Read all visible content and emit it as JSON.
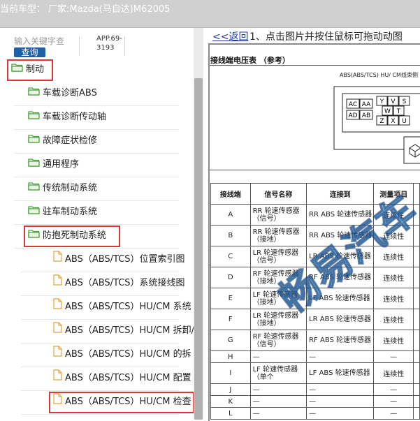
{
  "header": {
    "vehicle": "当前车型： 厂家:Mazda(马自达)M62005"
  },
  "search": {
    "placeholder": "输入关键字查",
    "button": "查询",
    "app_code": "APP.69-3193"
  },
  "tree": [
    {
      "label": "制动",
      "level": 0,
      "icon": "folder-open-icon",
      "highlight": true
    },
    {
      "label": "车载诊断ABS",
      "level": 1,
      "icon": "folder-open-icon"
    },
    {
      "label": "车载诊断传动轴",
      "level": 1,
      "icon": "folder-open-icon"
    },
    {
      "label": "故障症状检修",
      "level": 1,
      "icon": "folder-open-icon"
    },
    {
      "label": "通用程序",
      "level": 1,
      "icon": "folder-open-icon"
    },
    {
      "label": "传统制动系统",
      "level": 1,
      "icon": "folder-open-icon"
    },
    {
      "label": "驻车制动系统",
      "level": 1,
      "icon": "folder-open-icon"
    },
    {
      "label": "防抱死制动系统",
      "level": 1,
      "icon": "folder-open-icon",
      "highlight": true
    },
    {
      "label": "ABS（ABS/TCS）位置索引图",
      "level": 2,
      "icon": "document-icon"
    },
    {
      "label": "ABS（ABS/TCS）系统接线图",
      "level": 2,
      "icon": "document-icon"
    },
    {
      "label": "ABS（ABS/TCS）HU/CM 系统",
      "level": 2,
      "icon": "document-icon"
    },
    {
      "label": "ABS（ABS/TCS）HU/CM 拆卸/",
      "level": 2,
      "icon": "document-icon"
    },
    {
      "label": "ABS（ABS/TCS）HU/CM 的拆",
      "level": 2,
      "icon": "document-icon"
    },
    {
      "label": "ABS（ABS/TCS）HU/CM 配置",
      "level": 2,
      "icon": "document-icon"
    },
    {
      "label": "ABS（ABS/TCS）HU/CM 检查",
      "level": 2,
      "icon": "document-icon",
      "highlight": true
    }
  ],
  "content": {
    "back_link": "<<返回",
    "instruction": "1、点击图片并按住鼠标可拖动动图",
    "section_title": "接线端电压表 （参考）",
    "diagram_label": "ABS(ABS/TCS) HU/ CM线束侧",
    "connector_pins": [
      "AC",
      "AA",
      "AD",
      "AB",
      "Y",
      "V",
      "S",
      "W",
      "T",
      "Z",
      "X",
      "U"
    ],
    "table": {
      "headers": [
        "接线端",
        "信号名称",
        "连接到",
        "测量项目"
      ],
      "rows": [
        [
          "A",
          "RR 轮速传感器（信号）",
          "RR ABS 轮速传感器",
          "连续性"
        ],
        [
          "B",
          "RR 轮速传感器（接地）",
          "RR ABS 轮速传感器",
          "连续性"
        ],
        [
          "C",
          "LR 轮速传感器（信号）",
          "LR ABS 轮速传感器",
          "连续性"
        ],
        [
          "D",
          "RF 轮速传感器（接地）",
          "RF ABS 轮速传感器",
          "连续性"
        ],
        [
          "E",
          "LF 轮速传感器（接地）",
          "LF ABS 轮速传感器",
          "连续性"
        ],
        [
          "F",
          "LR 轮速传感器（接地）",
          "LR ABS 轮速传感器",
          "连续性"
        ],
        [
          "G",
          "RF 轮速传感器（信号）",
          "RF ABS 轮速传感器",
          "连续性"
        ],
        [
          "H",
          "—",
          "—",
          "—"
        ],
        [
          "I",
          "LF 轮速传感器（单个",
          "LF ABS 轮速传感器",
          "连续性"
        ],
        [
          "J",
          "—",
          "—",
          "—"
        ],
        [
          "K",
          "—",
          "—",
          "—"
        ],
        [
          "L",
          "—",
          "—",
          "—"
        ]
      ]
    },
    "watermark": "畅易汽车"
  }
}
